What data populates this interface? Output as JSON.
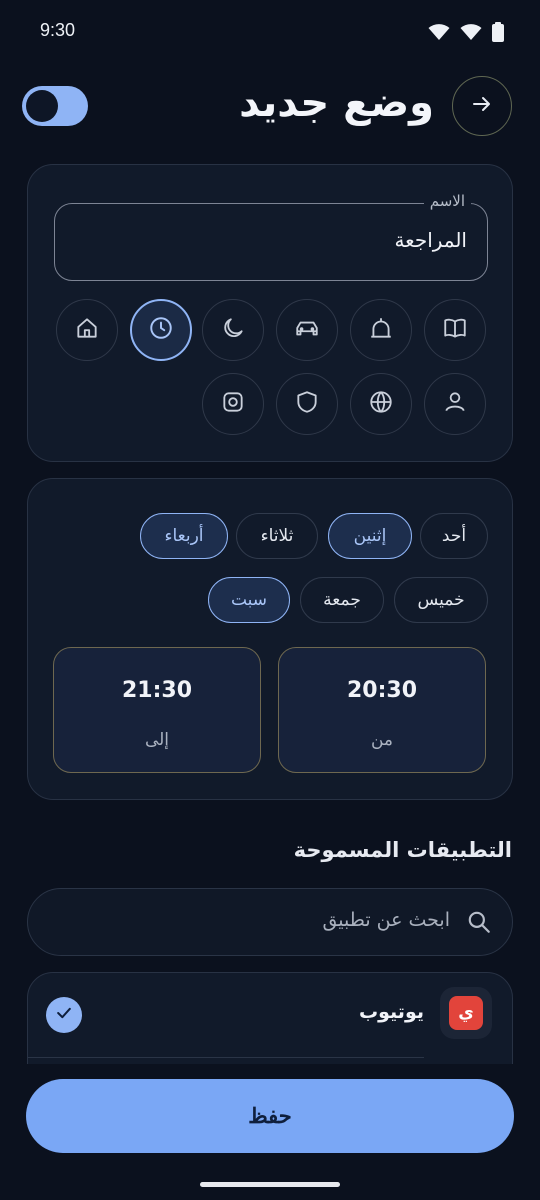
{
  "status_bar": {
    "time": "9:30",
    "icons": [
      "wifi-icon",
      "signal-icon",
      "battery-icon"
    ]
  },
  "header": {
    "title": "وضع جديد",
    "back_icon": "arrow-right-icon",
    "toggle_on": true
  },
  "name_field": {
    "label": "الاسم",
    "value": "المراجعة"
  },
  "mode_icons": [
    {
      "name": "book-icon",
      "selected": false
    },
    {
      "name": "mosque-icon",
      "selected": false
    },
    {
      "name": "car-icon",
      "selected": false
    },
    {
      "name": "moon-icon",
      "selected": false
    },
    {
      "name": "clock-icon",
      "selected": true
    },
    {
      "name": "home-icon",
      "selected": false
    },
    {
      "name": "person-icon",
      "selected": false
    },
    {
      "name": "globe-icon",
      "selected": false
    },
    {
      "name": "shield-icon",
      "selected": false
    },
    {
      "name": "instagram-icon",
      "selected": false
    }
  ],
  "days": [
    {
      "label": "أحد",
      "selected": false
    },
    {
      "label": "إثنين",
      "selected": true
    },
    {
      "label": "ثلاثاء",
      "selected": false
    },
    {
      "label": "أربعاء",
      "selected": true
    },
    {
      "label": "خميس",
      "selected": false
    },
    {
      "label": "جمعة",
      "selected": false
    },
    {
      "label": "سبت",
      "selected": true
    }
  ],
  "time_range": {
    "from": {
      "value": "20:30",
      "label": "من"
    },
    "to": {
      "value": "21:30",
      "label": "إلى"
    }
  },
  "allowed_apps": {
    "title": "التطبيقات المسموحة",
    "search_placeholder": "ابحث عن تطبيق",
    "items": [
      {
        "name": "يوتيوب",
        "icon_letter": "ي",
        "checked": true
      }
    ]
  },
  "save_label": "حفظ",
  "colors": {
    "accent": "#8fb4f5",
    "background": "#0b111e",
    "card": "#111a2a",
    "app_icon": "#e2443b"
  }
}
